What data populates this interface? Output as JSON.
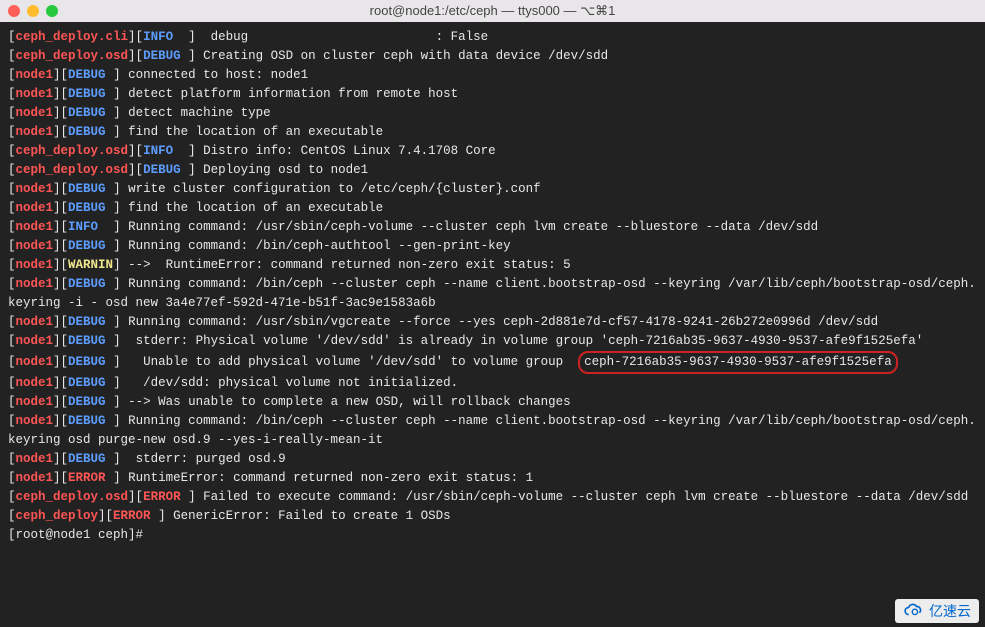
{
  "window": {
    "title": "root@node1:/etc/ceph — ttys000 — ⌥⌘1"
  },
  "highlighted_vg": "ceph-7216ab35-9637-4930-9537-afe9f1525efa",
  "watermark": {
    "text": "亿速云"
  },
  "lines": [
    {
      "segs": [
        {
          "t": "[",
          "c": "w"
        },
        {
          "t": "ceph_deploy.cli",
          "c": "r"
        },
        {
          "t": "][",
          "c": "w"
        },
        {
          "t": "INFO",
          "c": "b"
        },
        {
          "t": "  ]  debug                         : False",
          "c": "w"
        }
      ]
    },
    {
      "segs": [
        {
          "t": "[",
          "c": "w"
        },
        {
          "t": "ceph_deploy.osd",
          "c": "r"
        },
        {
          "t": "][",
          "c": "w"
        },
        {
          "t": "DEBUG",
          "c": "b"
        },
        {
          "t": " ] Creating OSD on cluster ceph with data device /dev/sdd",
          "c": "w"
        }
      ]
    },
    {
      "segs": [
        {
          "t": "[",
          "c": "w"
        },
        {
          "t": "node1",
          "c": "r"
        },
        {
          "t": "][",
          "c": "w"
        },
        {
          "t": "DEBUG",
          "c": "b"
        },
        {
          "t": " ] connected to host: node1",
          "c": "w"
        }
      ]
    },
    {
      "segs": [
        {
          "t": "[",
          "c": "w"
        },
        {
          "t": "node1",
          "c": "r"
        },
        {
          "t": "][",
          "c": "w"
        },
        {
          "t": "DEBUG",
          "c": "b"
        },
        {
          "t": " ] detect platform information from remote host",
          "c": "w"
        }
      ]
    },
    {
      "segs": [
        {
          "t": "[",
          "c": "w"
        },
        {
          "t": "node1",
          "c": "r"
        },
        {
          "t": "][",
          "c": "w"
        },
        {
          "t": "DEBUG",
          "c": "b"
        },
        {
          "t": " ] detect machine type",
          "c": "w"
        }
      ]
    },
    {
      "segs": [
        {
          "t": "[",
          "c": "w"
        },
        {
          "t": "node1",
          "c": "r"
        },
        {
          "t": "][",
          "c": "w"
        },
        {
          "t": "DEBUG",
          "c": "b"
        },
        {
          "t": " ] find the location of an executable",
          "c": "w"
        }
      ]
    },
    {
      "segs": [
        {
          "t": "[",
          "c": "w"
        },
        {
          "t": "ceph_deploy.osd",
          "c": "r"
        },
        {
          "t": "][",
          "c": "w"
        },
        {
          "t": "INFO",
          "c": "b"
        },
        {
          "t": "  ] Distro info: CentOS Linux 7.4.1708 Core",
          "c": "w"
        }
      ]
    },
    {
      "segs": [
        {
          "t": "[",
          "c": "w"
        },
        {
          "t": "ceph_deploy.osd",
          "c": "r"
        },
        {
          "t": "][",
          "c": "w"
        },
        {
          "t": "DEBUG",
          "c": "b"
        },
        {
          "t": " ] Deploying osd to node1",
          "c": "w"
        }
      ]
    },
    {
      "segs": [
        {
          "t": "[",
          "c": "w"
        },
        {
          "t": "node1",
          "c": "r"
        },
        {
          "t": "][",
          "c": "w"
        },
        {
          "t": "DEBUG",
          "c": "b"
        },
        {
          "t": " ] write cluster configuration to /etc/ceph/{cluster}.conf",
          "c": "w"
        }
      ]
    },
    {
      "segs": [
        {
          "t": "[",
          "c": "w"
        },
        {
          "t": "node1",
          "c": "r"
        },
        {
          "t": "][",
          "c": "w"
        },
        {
          "t": "DEBUG",
          "c": "b"
        },
        {
          "t": " ] find the location of an executable",
          "c": "w"
        }
      ]
    },
    {
      "segs": [
        {
          "t": "[",
          "c": "w"
        },
        {
          "t": "node1",
          "c": "r"
        },
        {
          "t": "][",
          "c": "w"
        },
        {
          "t": "INFO",
          "c": "b"
        },
        {
          "t": "  ] Running command: /usr/sbin/ceph-volume --cluster ceph lvm create --bluestore --data /dev/sdd",
          "c": "w"
        }
      ]
    },
    {
      "segs": [
        {
          "t": "[",
          "c": "w"
        },
        {
          "t": "node1",
          "c": "r"
        },
        {
          "t": "][",
          "c": "w"
        },
        {
          "t": "DEBUG",
          "c": "b"
        },
        {
          "t": " ] Running command: /bin/ceph-authtool --gen-print-key",
          "c": "w"
        }
      ]
    },
    {
      "segs": [
        {
          "t": "[",
          "c": "w"
        },
        {
          "t": "node1",
          "c": "r"
        },
        {
          "t": "][",
          "c": "w"
        },
        {
          "t": "WARNIN",
          "c": "y"
        },
        {
          "t": "] -->  RuntimeError: command returned non-zero exit status: 5",
          "c": "w"
        }
      ]
    },
    {
      "segs": [
        {
          "t": "[",
          "c": "w"
        },
        {
          "t": "node1",
          "c": "r"
        },
        {
          "t": "][",
          "c": "w"
        },
        {
          "t": "DEBUG",
          "c": "b"
        },
        {
          "t": " ] Running command: /bin/ceph --cluster ceph --name client.bootstrap-osd --keyring /var/lib/ceph/bootstrap-osd/ceph.keyring -i - osd new 3a4e77ef-592d-471e-b51f-3ac9e1583a6b",
          "c": "w"
        }
      ]
    },
    {
      "segs": [
        {
          "t": "[",
          "c": "w"
        },
        {
          "t": "node1",
          "c": "r"
        },
        {
          "t": "][",
          "c": "w"
        },
        {
          "t": "DEBUG",
          "c": "b"
        },
        {
          "t": " ] Running command: /usr/sbin/vgcreate --force --yes ceph-2d881e7d-cf57-4178-9241-26b272e0996d /dev/sdd",
          "c": "w"
        }
      ]
    },
    {
      "segs": [
        {
          "t": "[",
          "c": "w"
        },
        {
          "t": "node1",
          "c": "r"
        },
        {
          "t": "][",
          "c": "w"
        },
        {
          "t": "DEBUG",
          "c": "b"
        },
        {
          "t": " ]  stderr: Physical volume '/dev/sdd' is already in volume group 'ceph-7216ab35-9637-4930-9537-afe9f1525efa'",
          "c": "w"
        }
      ]
    },
    {
      "segs": [
        {
          "t": "[",
          "c": "w"
        },
        {
          "t": "node1",
          "c": "r"
        },
        {
          "t": "][",
          "c": "w"
        },
        {
          "t": "DEBUG",
          "c": "b"
        },
        {
          "t": " ]   Unable to add physical volume '/dev/sdd' to volume group  ",
          "c": "w"
        }
      ],
      "hl": true
    },
    {
      "segs": [
        {
          "t": "[",
          "c": "w"
        },
        {
          "t": "node1",
          "c": "r"
        },
        {
          "t": "][",
          "c": "w"
        },
        {
          "t": "DEBUG",
          "c": "b"
        },
        {
          "t": " ]   /dev/sdd: physical volume not initialized.",
          "c": "w"
        }
      ]
    },
    {
      "segs": [
        {
          "t": "[",
          "c": "w"
        },
        {
          "t": "node1",
          "c": "r"
        },
        {
          "t": "][",
          "c": "w"
        },
        {
          "t": "DEBUG",
          "c": "b"
        },
        {
          "t": " ] --> Was unable to complete a new OSD, will rollback changes",
          "c": "w"
        }
      ]
    },
    {
      "segs": [
        {
          "t": "[",
          "c": "w"
        },
        {
          "t": "node1",
          "c": "r"
        },
        {
          "t": "][",
          "c": "w"
        },
        {
          "t": "DEBUG",
          "c": "b"
        },
        {
          "t": " ] Running command: /bin/ceph --cluster ceph --name client.bootstrap-osd --keyring /var/lib/ceph/bootstrap-osd/ceph.keyring osd purge-new osd.9 --yes-i-really-mean-it",
          "c": "w"
        }
      ]
    },
    {
      "segs": [
        {
          "t": "[",
          "c": "w"
        },
        {
          "t": "node1",
          "c": "r"
        },
        {
          "t": "][",
          "c": "w"
        },
        {
          "t": "DEBUG",
          "c": "b"
        },
        {
          "t": " ]  stderr: purged osd.9",
          "c": "w"
        }
      ]
    },
    {
      "segs": [
        {
          "t": "[",
          "c": "w"
        },
        {
          "t": "node1",
          "c": "r"
        },
        {
          "t": "][",
          "c": "w"
        },
        {
          "t": "ERROR",
          "c": "e"
        },
        {
          "t": " ] RuntimeError: command returned non-zero exit status: 1",
          "c": "w"
        }
      ]
    },
    {
      "segs": [
        {
          "t": "[",
          "c": "w"
        },
        {
          "t": "ceph_deploy.osd",
          "c": "r"
        },
        {
          "t": "][",
          "c": "w"
        },
        {
          "t": "ERROR",
          "c": "e"
        },
        {
          "t": " ] Failed to execute command: /usr/sbin/ceph-volume --cluster ceph lvm create --bluestore --data /dev/sdd",
          "c": "w"
        }
      ]
    },
    {
      "segs": [
        {
          "t": "[",
          "c": "w"
        },
        {
          "t": "ceph_deploy",
          "c": "r"
        },
        {
          "t": "][",
          "c": "w"
        },
        {
          "t": "ERROR",
          "c": "e"
        },
        {
          "t": " ] GenericError: Failed to create 1 OSDs",
          "c": "w"
        }
      ]
    }
  ],
  "prompt": "[root@node1 ceph]#"
}
